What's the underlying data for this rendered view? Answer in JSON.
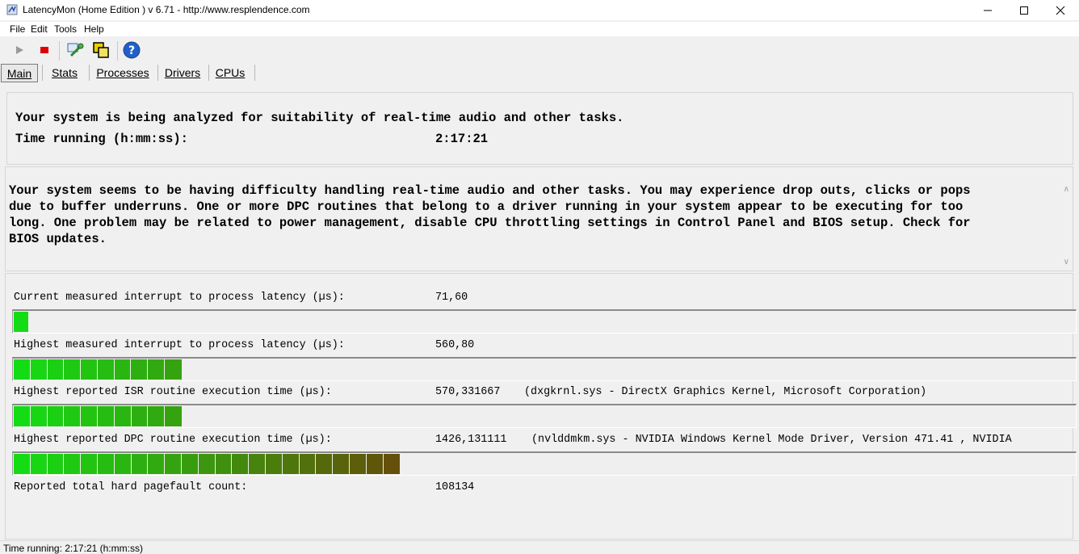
{
  "window": {
    "title": "LatencyMon  (Home Edition )  v 6.71 - http://www.resplendence.com"
  },
  "menu": [
    "File",
    "Edit",
    "Tools",
    "Help"
  ],
  "toolbar": {
    "icons": [
      "play-icon",
      "stop-icon",
      "driver-tool-icon",
      "cpu-icon",
      "help-icon"
    ]
  },
  "tabs": [
    "Main",
    "Stats",
    "Processes",
    "Drivers",
    "CPUs"
  ],
  "active_tab": "Main",
  "analysis": {
    "line1": "Your system is being analyzed for suitability of real-time audio and other tasks.",
    "time_label": "Time running (h:mm:ss):",
    "time_value": "2:17:21"
  },
  "verdict": {
    "line1": "Your system seems to be having difficulty handling real-time audio and other tasks. You may experience drop outs, clicks or pops",
    "line2": "due to buffer underruns. One or more DPC routines that belong to a driver running in your system appear to be executing for too",
    "line3": "long. One problem may be related to power management, disable CPU throttling settings in Control Panel and BIOS setup. Check for",
    "line4": "BIOS updates."
  },
  "metrics": [
    {
      "label": "Current measured interrupt to process latency (µs):",
      "value": "71,60",
      "extra": "",
      "bar_level": 0.014
    },
    {
      "label": "Highest measured interrupt to process latency (µs):",
      "value": "560,80",
      "extra": "",
      "bar_level": 0.158
    },
    {
      "label": "Highest reported ISR routine execution time (µs):",
      "value": "570,331667",
      "extra": "(dxgkrnl.sys - DirectX Graphics Kernel, Microsoft Corporation)",
      "bar_level": 0.166
    },
    {
      "label": "Highest reported DPC routine execution time (µs):",
      "value": "1426,131111",
      "extra": "(nvlddmkm.sys - NVIDIA Windows Kernel Mode Driver, Version 471.41 , NVIDIA",
      "bar_level": 0.366
    },
    {
      "label": "Reported total hard pagefault count:",
      "value": "108134",
      "extra": ""
    }
  ],
  "status": "Time running: 2:17:21  (h:mm:ss)"
}
